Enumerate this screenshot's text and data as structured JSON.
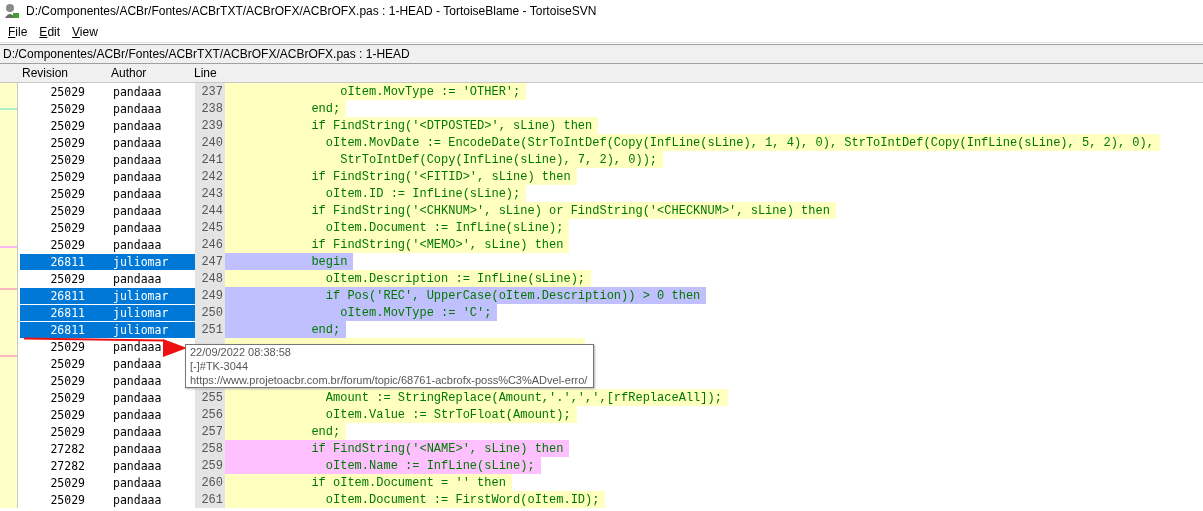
{
  "window": {
    "title": "D:/Componentes/ACBr/Fontes/ACBrTXT/ACBrOFX/ACBrOFX.pas : 1-HEAD - TortoiseBlame - TortoiseSVN"
  },
  "menu": [
    "File",
    "Edit",
    "View"
  ],
  "path_bar": "D:/Componentes/ACBr/Fontes/ACBrTXT/ACBrOFX/ACBrOFX.pas : 1-HEAD",
  "columns": [
    "Revision",
    "Author",
    "Line"
  ],
  "rows": [
    {
      "revision": "25029",
      "author": "pandaaa",
      "line": "237",
      "code": "                oItem.MovType := 'OTHER';",
      "color": "#ffffc0",
      "selected": false
    },
    {
      "revision": "25029",
      "author": "pandaaa",
      "line": "238",
      "code": "            end;",
      "color": "#ffffc0",
      "selected": false
    },
    {
      "revision": "25029",
      "author": "pandaaa",
      "line": "239",
      "code": "            if FindString('<DTPOSTED>', sLine) then",
      "color": "#ffffc0",
      "selected": false
    },
    {
      "revision": "25029",
      "author": "pandaaa",
      "line": "240",
      "code": "              oItem.MovDate := EncodeDate(StrToIntDef(Copy(InfLine(sLine), 1, 4), 0), StrToIntDef(Copy(InfLine(sLine), 5, 2), 0),",
      "color": "#ffffc0",
      "selected": false
    },
    {
      "revision": "25029",
      "author": "pandaaa",
      "line": "241",
      "code": "                StrToIntDef(Copy(InfLine(sLine), 7, 2), 0));",
      "color": "#ffffc0",
      "selected": false
    },
    {
      "revision": "25029",
      "author": "pandaaa",
      "line": "242",
      "code": "            if FindString('<FITID>', sLine) then",
      "color": "#ffffc0",
      "selected": false
    },
    {
      "revision": "25029",
      "author": "pandaaa",
      "line": "243",
      "code": "              oItem.ID := InfLine(sLine);",
      "color": "#ffffc0",
      "selected": false
    },
    {
      "revision": "25029",
      "author": "pandaaa",
      "line": "244",
      "code": "            if FindString('<CHKNUM>', sLine) or FindString('<CHECKNUM>', sLine) then",
      "color": "#ffffc0",
      "selected": false
    },
    {
      "revision": "25029",
      "author": "pandaaa",
      "line": "245",
      "code": "              oItem.Document := InfLine(sLine);",
      "color": "#ffffc0",
      "selected": false
    },
    {
      "revision": "25029",
      "author": "pandaaa",
      "line": "246",
      "code": "            if FindString('<MEMO>', sLine) then",
      "color": "#ffffc0",
      "selected": false
    },
    {
      "revision": "26811",
      "author": "juliomar",
      "line": "247",
      "code": "            begin",
      "color": "#c0c0ff",
      "selected": true
    },
    {
      "revision": "25029",
      "author": "pandaaa",
      "line": "248",
      "code": "              oItem.Description := InfLine(sLine);",
      "color": "#ffffc0",
      "selected": false
    },
    {
      "revision": "26811",
      "author": "juliomar",
      "line": "249",
      "code": "              if Pos('REC', UpperCase(oItem.Description)) > 0 then",
      "color": "#c0c0ff",
      "selected": true
    },
    {
      "revision": "26811",
      "author": "juliomar",
      "line": "250",
      "code": "                oItem.MovType := 'C';",
      "color": "#c0c0ff",
      "selected": true
    },
    {
      "revision": "26811",
      "author": "juliomar",
      "line": "251",
      "code": "            end;",
      "color": "#c0c0ff",
      "selected": true
    },
    {
      "revision": "25029",
      "author": "pandaaa",
      "color": "#ffffc0",
      "selected": false
    },
    {
      "revision": "25029",
      "author": "pandaaa",
      "selected": false
    },
    {
      "revision": "25029",
      "author": "pandaaa",
      "selected": false
    },
    {
      "revision": "25029",
      "author": "pandaaa",
      "line": "255",
      "code": "              Amount := StringReplace(Amount,'.',',',[rfReplaceAll]);",
      "color": "#ffffc0",
      "selected": false
    },
    {
      "revision": "25029",
      "author": "pandaaa",
      "line": "256",
      "code": "              oItem.Value := StrToFloat(Amount);",
      "color": "#ffffc0",
      "selected": false
    },
    {
      "revision": "25029",
      "author": "pandaaa",
      "line": "257",
      "code": "            end;",
      "color": "#ffffc0",
      "selected": false
    },
    {
      "revision": "27282",
      "author": "pandaaa",
      "line": "258",
      "code": "            if FindString('<NAME>', sLine) then",
      "color": "#ffc0ff",
      "selected": false
    },
    {
      "revision": "27282",
      "author": "pandaaa",
      "line": "259",
      "code": "              oItem.Name := InfLine(sLine);",
      "color": "#ffc0ff",
      "selected": false
    },
    {
      "revision": "25029",
      "author": "pandaaa",
      "line": "260",
      "code": "            if oItem.Document = '' then",
      "color": "#ffffc0",
      "selected": false
    },
    {
      "revision": "25029",
      "author": "pandaaa",
      "line": "261",
      "code": "              oItem.Document := FirstWord(oItem.ID);",
      "color": "#ffffc0",
      "selected": false
    }
  ],
  "tooltip": [
    "22/09/2022 08:38:58",
    "[-]#TK-3044",
    "https://www.projetoacbr.com.br/forum/topic/68761-acbrofx-poss%C3%ADvel-erro/"
  ]
}
